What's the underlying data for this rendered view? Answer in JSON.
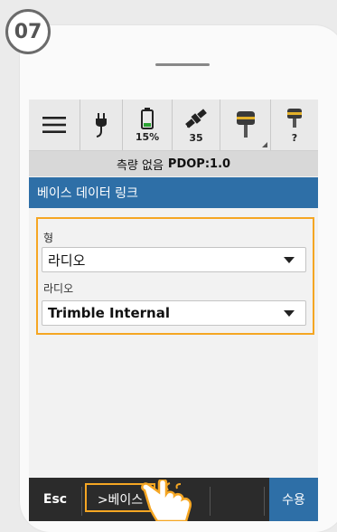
{
  "step": "07",
  "status": {
    "battery_percent": "15%",
    "satellites": "35",
    "receiver2_value": "?"
  },
  "pdop_bar": {
    "status": "측량 없음",
    "pdop": "PDOP:1.0"
  },
  "screen_title": "베이스 데이터 링크",
  "form": {
    "type_label": "형",
    "type_value": "라디오",
    "radio_label": "라디오",
    "radio_value": "Trimble Internal"
  },
  "bottom_bar": {
    "esc": "Esc",
    "base": ">베이스",
    "accept": "수용"
  },
  "colors": {
    "title_blue": "#2e6fa7",
    "highlight_orange": "#f5a623",
    "accept_blue": "#2e6fa7",
    "battery_green": "#2aa332"
  }
}
